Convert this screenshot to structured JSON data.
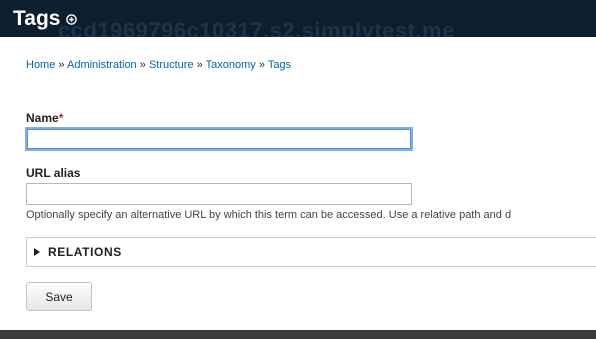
{
  "header": {
    "title": "Tags",
    "ghost_text": "ccd1969796c10317.s2.simplytest.me",
    "shortcut_icon": "plus-circle-icon",
    "background": "#0c1f2e"
  },
  "breadcrumb": {
    "items": [
      "Home",
      "Administration",
      "Structure",
      "Taxonomy",
      "Tags"
    ],
    "separator": "»"
  },
  "form": {
    "name": {
      "label": "Name",
      "required_marker": "*",
      "value": ""
    },
    "url_alias": {
      "label": "URL alias",
      "value": "",
      "description": "Optionally specify an alternative URL by which this term can be accessed. Use a relative path and d"
    },
    "relations": {
      "label": "RELATIONS",
      "icon": "triangle-right-icon"
    },
    "save_label": "Save"
  },
  "colors": {
    "link": "#0066aa",
    "required": "#cc2222",
    "focus": "#7fb1e5",
    "footer": "#3b3b3b"
  }
}
